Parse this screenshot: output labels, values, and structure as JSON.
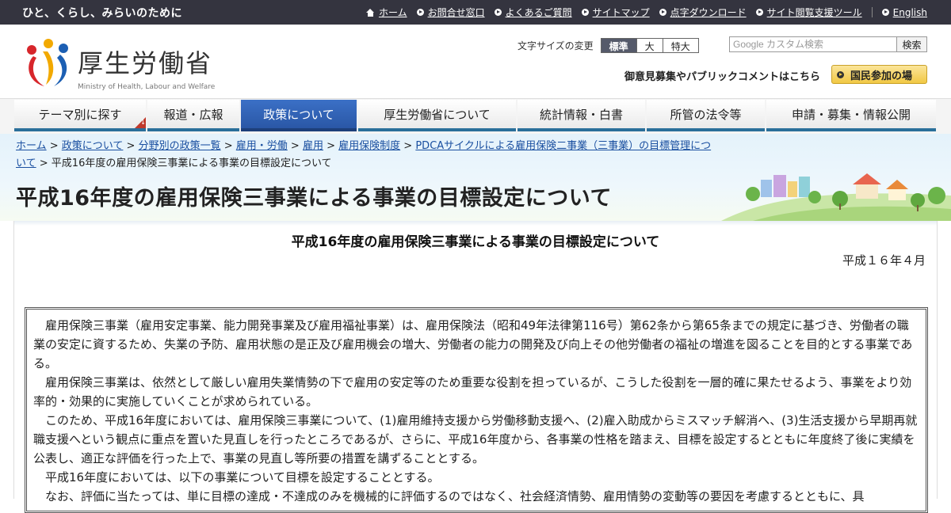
{
  "topbar": {
    "tagline": "ひと、くらし、みらいのために",
    "links": [
      {
        "label": "ホーム",
        "icon": "home-icon"
      },
      {
        "label": "お問合せ窓口",
        "icon": "arrow-circle-icon"
      },
      {
        "label": "よくあるご質問",
        "icon": "arrow-circle-icon"
      },
      {
        "label": "サイトマップ",
        "icon": "arrow-circle-icon"
      },
      {
        "label": "点字ダウンロード",
        "icon": "arrow-circle-icon"
      },
      {
        "label": "サイト閲覧支援ツール",
        "icon": "arrow-circle-icon"
      },
      {
        "label": "English",
        "icon": "arrow-circle-icon"
      }
    ]
  },
  "header": {
    "logo_name": "厚生労働省",
    "logo_sub": "Ministry of Health, Labour and Welfare",
    "fontsize": {
      "label": "文字サイズの変更",
      "options": [
        "標準",
        "大",
        "特大"
      ],
      "selected": "標準"
    },
    "search": {
      "placeholder": "Google カスタム検索",
      "button": "検索"
    },
    "pubcomment": "御意見募集やパブリックコメントはこちら",
    "kokumin": "国民参加の場"
  },
  "gnav": {
    "items": [
      "テーマ別に探す",
      "報道・広報",
      "政策について",
      "厚生労働省について",
      "統計情報・白書",
      "所管の法令等",
      "申請・募集・情報公開"
    ],
    "active": "政策について"
  },
  "breadcrumb": {
    "links": [
      "ホーム",
      "政策について",
      "分野別の政策一覧",
      "雇用・労働",
      "雇用",
      "雇用保険制度",
      "PDCAサイクルによる雇用保険二事業（三事業）の目標管理につ",
      "いて"
    ],
    "current": "平成16年度の雇用保険三事業による事業の目標設定について"
  },
  "page_title": "平成16年度の雇用保険三事業による事業の目標設定について",
  "document": {
    "title": "平成16年度の雇用保険三事業による事業の目標設定について",
    "date": "平成１６年４月",
    "paragraphs": [
      "雇用保険三事業（雇用安定事業、能力開発事業及び雇用福祉事業）は、雇用保険法（昭和49年法律第116号）第62条から第65条までの規定に基づき、労働者の職業の安定に資するため、失業の予防、雇用状態の是正及び雇用機会の増大、労働者の能力の開発及び向上その他労働者の福祉の増進を図ることを目的とする事業である。",
      "雇用保険三事業は、依然として厳しい雇用失業情勢の下で雇用の安定等のため重要な役割を担っているが、こうした役割を一層的確に果たせるよう、事業をより効率的・効果的に実施していくことが求められている。",
      "このため、平成16年度においては、雇用保険三事業について、(1)雇用維持支援から労働移動支援へ、(2)雇入助成からミスマッチ解消へ、(3)生活支援から早期再就職支援へという観点に重点を置いた見直しを行ったところであるが、さらに、平成16年度から、各事業の性格を踏まえ、目標を設定するとともに年度終了後に実績を公表し、適正な評価を行った上で、事業の見直し等所要の措置を講ずることとする。",
      "平成16年度においては、以下の事業について目標を設定することとする。",
      "なお、評価に当たっては、単に目標の達成・不達成のみを機械的に評価するのではなく、社会経済情勢、雇用情勢の変動等の要因を考慮するとともに、具"
    ]
  }
}
